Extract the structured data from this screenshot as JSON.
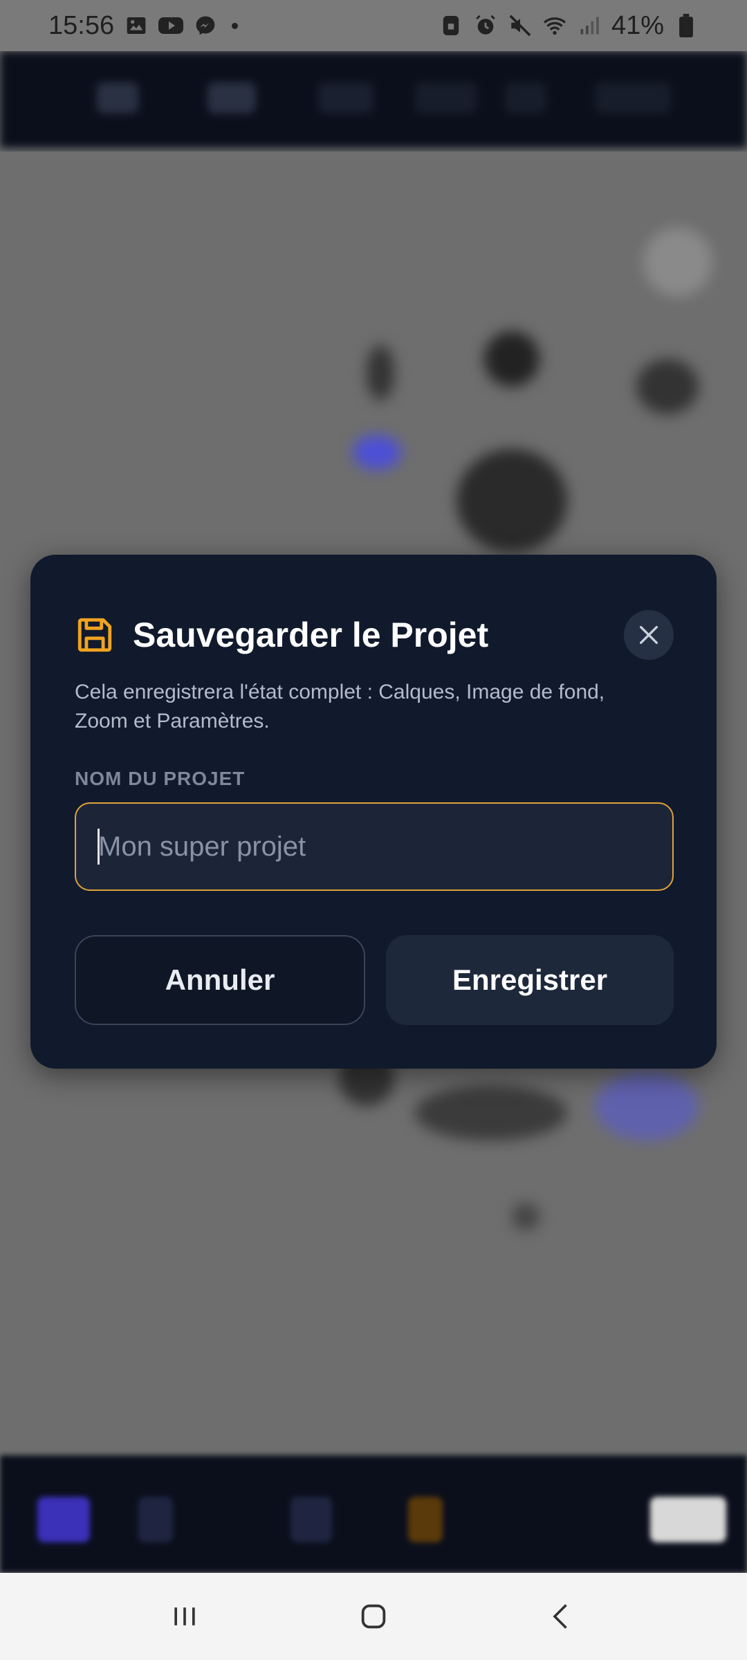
{
  "status_bar": {
    "time": "15:56",
    "battery": "41%",
    "left_icons": [
      "gallery-icon",
      "youtube-icon",
      "messenger-icon",
      "notification-dot"
    ],
    "right_icons": [
      "vpn-lock-icon",
      "alarm-icon",
      "mute-icon",
      "wifi-icon",
      "signal-icon",
      "battery-icon"
    ]
  },
  "dialog": {
    "title": "Sauvegarder le Projet",
    "description": "Cela enregistrera l'état complet : Calques, Image de fond, Zoom et Paramètres.",
    "field_label": "NOM DU PROJET",
    "input_placeholder": "Mon super projet",
    "input_value": "",
    "cancel_label": "Annuler",
    "save_label": "Enregistrer",
    "accent_color": "#f0a321"
  },
  "nav_bar": {
    "buttons": [
      "recent-apps-icon",
      "home-icon",
      "back-icon"
    ]
  }
}
